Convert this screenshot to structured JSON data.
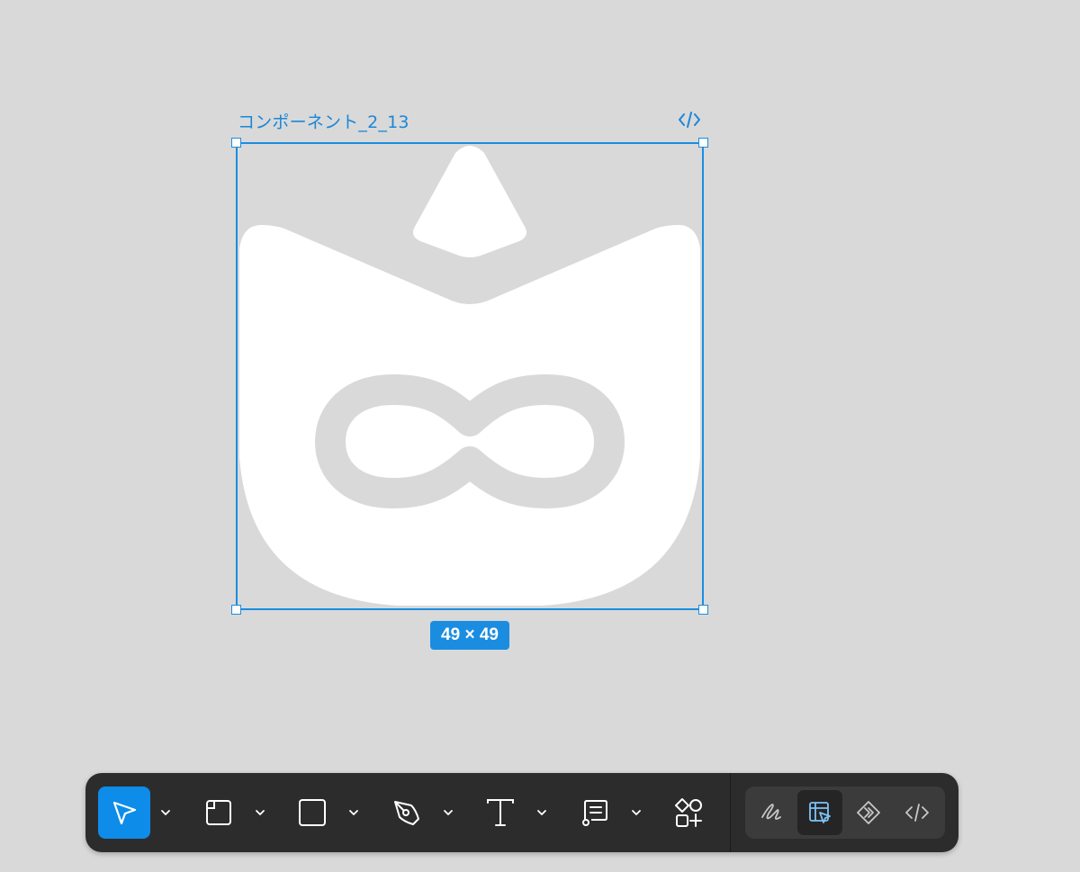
{
  "canvas": {
    "frame_name": "コンポーネント_2_13",
    "size_label": "49 × 49",
    "background": "#d9d9d9",
    "selection_color": "#1a8de0",
    "artwork_fill": "#ffffff"
  },
  "toolbar": {
    "tools": [
      {
        "id": "move",
        "icon": "cursor-arrow-icon",
        "active": true,
        "has_menu": true
      },
      {
        "id": "frame",
        "icon": "frame-icon",
        "active": false,
        "has_menu": true
      },
      {
        "id": "rectangle",
        "icon": "rectangle-icon",
        "active": false,
        "has_menu": true
      },
      {
        "id": "pen",
        "icon": "pen-tool-icon",
        "active": false,
        "has_menu": true
      },
      {
        "id": "text",
        "icon": "text-icon",
        "active": false,
        "has_menu": false
      },
      {
        "id": "comment",
        "icon": "comment-icon",
        "active": false,
        "has_menu": true
      },
      {
        "id": "assets",
        "icon": "shapes-plus-icon",
        "active": false,
        "has_menu": false
      }
    ],
    "modes": [
      {
        "id": "draw",
        "icon": "squiggle-icon",
        "active": false
      },
      {
        "id": "design",
        "icon": "design-mode-icon",
        "active": true
      },
      {
        "id": "prototype",
        "icon": "prototype-icon",
        "active": false
      },
      {
        "id": "dev",
        "icon": "code-brackets-icon",
        "active": false
      }
    ],
    "active_color": "#0d8ce9"
  }
}
